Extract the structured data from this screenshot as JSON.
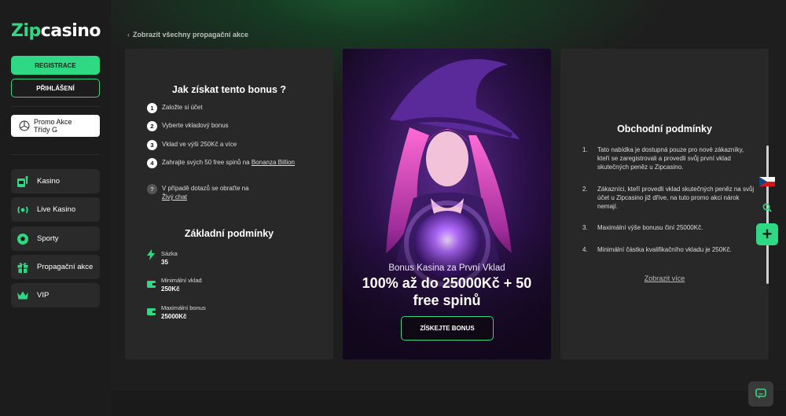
{
  "brand": {
    "logo_prefix": "Zip",
    "logo_suffix": "casino",
    "accent": "#2fd882"
  },
  "sidebar": {
    "register_label": "REGISTRACE",
    "login_label": "PŘIHLÁŠENÍ",
    "promo_line1": "Promo Akce",
    "promo_line2": "Třídy G",
    "items": [
      {
        "label": "Kasino",
        "icon": "casino-icon"
      },
      {
        "label": "Live Kasino",
        "icon": "live-icon"
      },
      {
        "label": "Sporty",
        "icon": "football-icon"
      },
      {
        "label": "Propagační akce",
        "icon": "gift-icon"
      },
      {
        "label": "VIP",
        "icon": "crown-icon"
      }
    ]
  },
  "back_link": "Zobrazit všechny propagační akce",
  "how_to": {
    "title": "Jak získat tento bonus ?",
    "steps": [
      {
        "num": "1",
        "text": "Založte si účet"
      },
      {
        "num": "2",
        "text": "Vyberte vkladový bonus"
      },
      {
        "num": "3",
        "text": "Vklad ve výši 250Kč a více"
      },
      {
        "num": "4",
        "text_before": "Zahrajte svých 50 free spinů na ",
        "link": "Bonanza Billion"
      },
      {
        "num": "?",
        "text": "V případě dotazů se obraťte na",
        "link": "Živý chat"
      }
    ]
  },
  "basic": {
    "title": "Základní podmínky",
    "items": [
      {
        "label": "Sázka",
        "value": "35",
        "icon": "bolt-icon"
      },
      {
        "label": "Minimální vklad",
        "value": "250Kč",
        "icon": "wallet-icon"
      },
      {
        "label": "Maximální bonus",
        "value": "25000Kč",
        "icon": "wallet-icon"
      }
    ]
  },
  "hero": {
    "subtitle": "Bonus Kasina za První Vklad",
    "title_line1": "100% až do 25000Kč + 50",
    "title_line2": "free spinů",
    "button": "ZÍSKEJTE BONUS"
  },
  "terms": {
    "title": "Obchodní podmínky",
    "items": [
      {
        "num": "1.",
        "text": "Tato nabídka je dostupná pouze pro nové zákazníky, kteří se zaregistrovali a provedli svůj první vklad skutečných peněz u Zipcasino."
      },
      {
        "num": "2.",
        "text": "Zákazníci, kteří provedli vklad skutečných peněz na svůj účet u Zipcasino již dříve, na tuto promo akci nárok nemají."
      },
      {
        "num": "3.",
        "text": "Maximální výše bonusu činí 25000Kč."
      },
      {
        "num": "4.",
        "text": "Minimální částka kvalifikačního vkladu je 250Kč."
      }
    ],
    "more_link": "Zobrazit více"
  },
  "widgets": {
    "language": "czech-flag-icon",
    "search": "search-icon",
    "add": "+",
    "chat": "chat-icon"
  }
}
